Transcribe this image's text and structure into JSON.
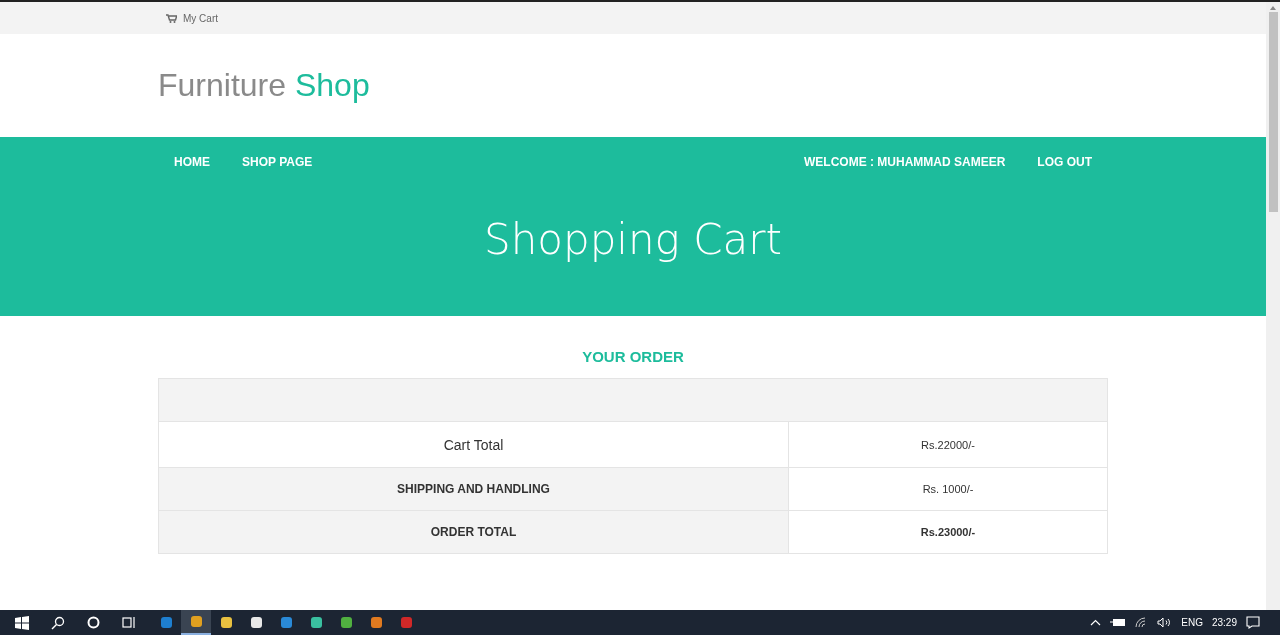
{
  "top_bar": {
    "cart_link": "My Cart"
  },
  "logo": {
    "first": "Furniture",
    "second": "Shop"
  },
  "nav": {
    "left": [
      "HOME",
      "SHOP PAGE"
    ],
    "welcome": "WELCOME : MUHAMMAD SAMEER",
    "logout": "LOG OUT"
  },
  "hero": {
    "title": "Shopping Cart"
  },
  "order": {
    "heading": "YOUR ORDER",
    "rows": [
      {
        "kind": "subtotal",
        "label": "Cart Total",
        "value": "Rs.22000/-"
      },
      {
        "kind": "shipping",
        "label": "SHIPPING AND HANDLING",
        "value": "Rs. 1000/-"
      },
      {
        "kind": "total",
        "label": "ORDER TOTAL",
        "value": "Rs.23000/-"
      }
    ]
  },
  "taskbar": {
    "apps": [
      {
        "selected": false
      },
      {
        "selected": true
      },
      {
        "selected": false
      },
      {
        "selected": false
      },
      {
        "selected": false
      },
      {
        "selected": false
      },
      {
        "selected": false
      },
      {
        "selected": false
      },
      {
        "selected": false
      }
    ],
    "language": "ENG",
    "time": "23:29"
  }
}
